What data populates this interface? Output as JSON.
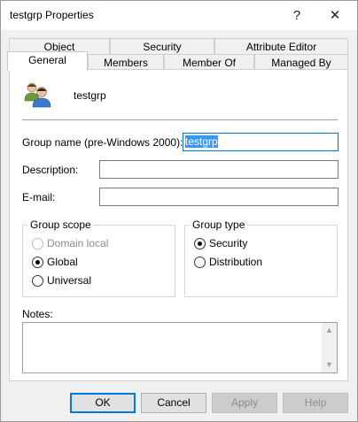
{
  "window": {
    "title": "testgrp Properties",
    "help_glyph": "?",
    "close_glyph": "✕"
  },
  "tabs": {
    "row1": [
      {
        "label": "Object"
      },
      {
        "label": "Security"
      },
      {
        "label": "Attribute Editor"
      }
    ],
    "row2": [
      {
        "label": "General",
        "active": true
      },
      {
        "label": "Members"
      },
      {
        "label": "Member Of"
      },
      {
        "label": "Managed By"
      }
    ]
  },
  "general": {
    "group_name": "testgrp",
    "group_icon": "group-icon",
    "pre_windows_label": "Group name (pre-Windows 2000):",
    "pre_windows_value": "testgrp",
    "description_label": "Description:",
    "description_value": "",
    "email_label": "E-mail:",
    "email_value": "",
    "scope": {
      "label": "Group scope",
      "options": [
        {
          "label": "Domain local",
          "checked": false,
          "disabled": true
        },
        {
          "label": "Global",
          "checked": true,
          "disabled": false
        },
        {
          "label": "Universal",
          "checked": false,
          "disabled": false
        }
      ]
    },
    "type": {
      "label": "Group type",
      "options": [
        {
          "label": "Security",
          "checked": true
        },
        {
          "label": "Distribution",
          "checked": false
        }
      ]
    },
    "notes_label": "Notes:",
    "notes_value": ""
  },
  "buttons": {
    "ok": "OK",
    "cancel": "Cancel",
    "apply": "Apply",
    "help": "Help"
  },
  "colors": {
    "focus_accent": "#0078d7",
    "selection": "#3399ff"
  }
}
